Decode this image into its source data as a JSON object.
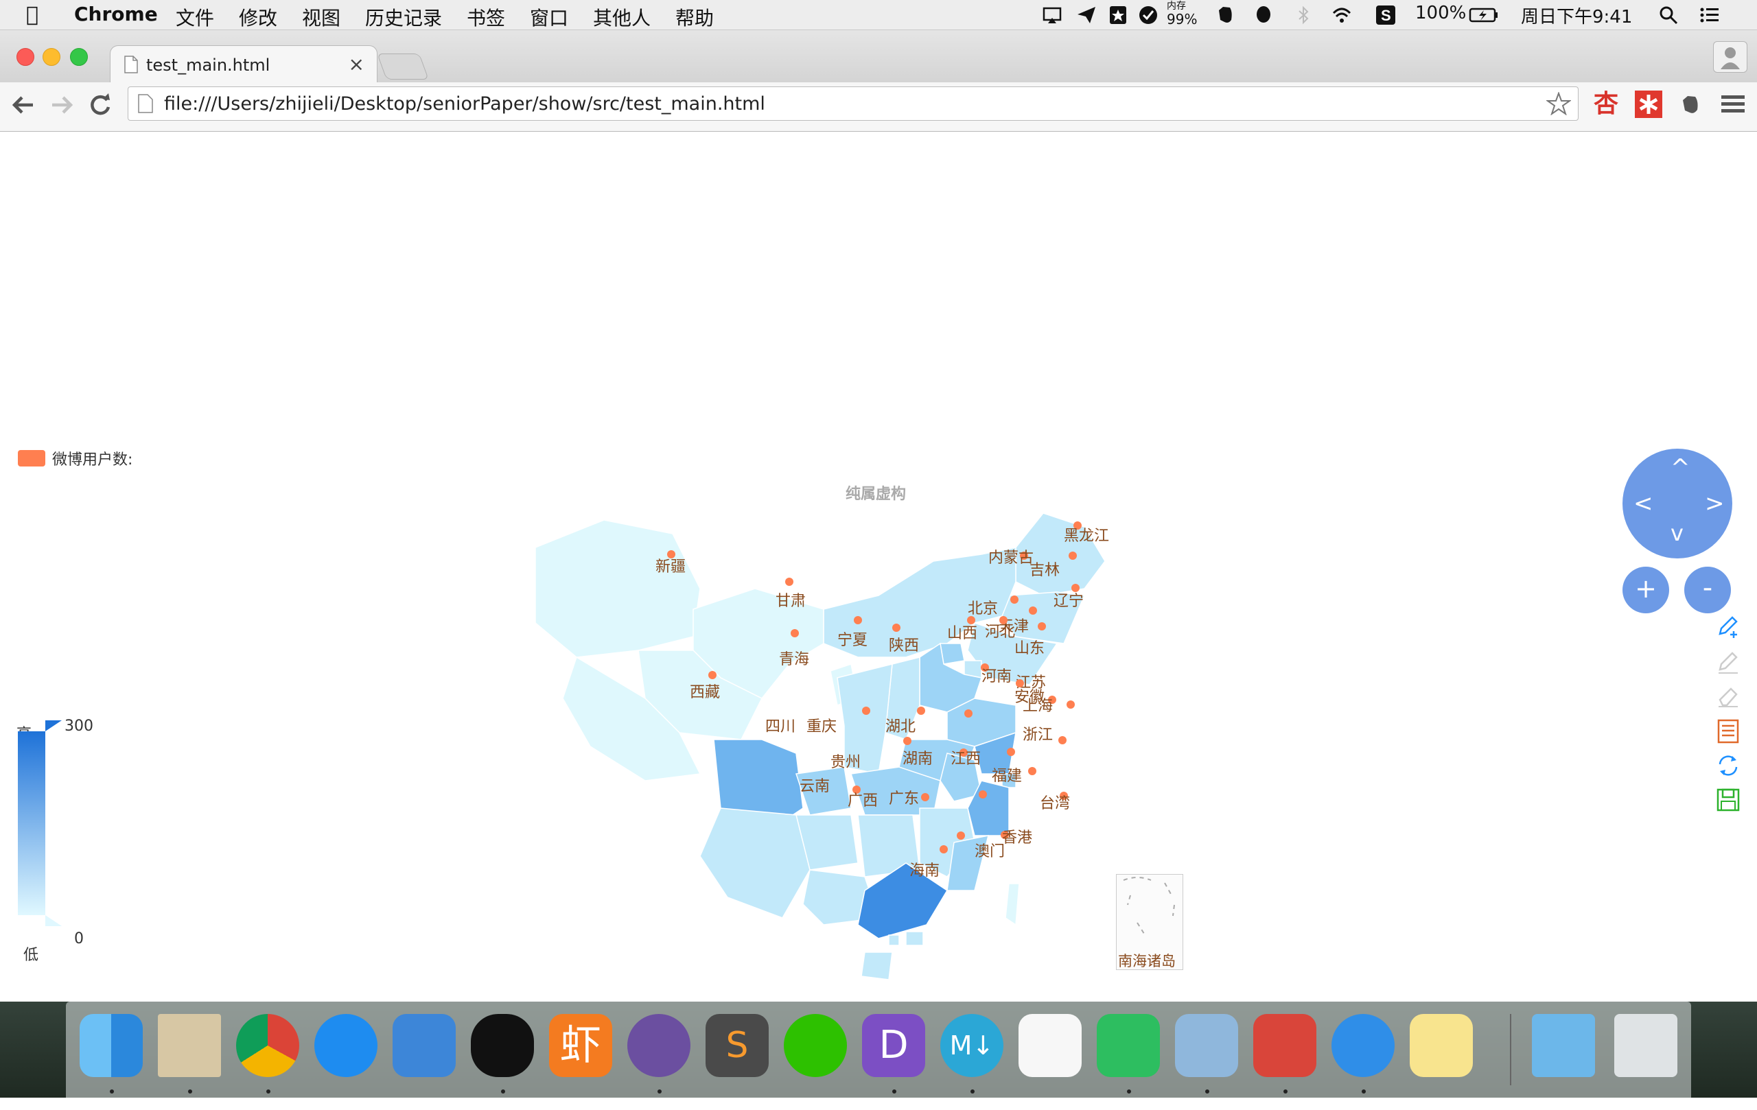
{
  "menubar": {
    "app_name": "Chrome",
    "items": [
      "文件",
      "修改",
      "视图",
      "历史记录",
      "书签",
      "窗口",
      "其他人",
      "帮助"
    ],
    "memory_label": "内存",
    "memory_value": "99%",
    "battery": "100%",
    "clock": "周日下午9:41"
  },
  "tab": {
    "title": "test_main.html",
    "close": "×"
  },
  "toolbar": {
    "url": "file:///Users/zhijieli/Desktop/seniorPaper/show/src/test_main.html"
  },
  "map": {
    "legend_label": "微博用户数:",
    "legend_color": "#ff7f50",
    "subtitle": "纯属虚构",
    "scale": {
      "high_label": "高",
      "low_label": "低",
      "max": "300",
      "min": "0",
      "color_high": "#1e72d8",
      "color_low": "#e0f8ff"
    },
    "provinces": [
      {
        "name": "黑龙江",
        "shade": 1
      },
      {
        "name": "吉林",
        "shade": 1
      },
      {
        "name": "辽宁",
        "shade": 1
      },
      {
        "name": "内蒙古",
        "shade": 1
      },
      {
        "name": "北京",
        "shade": 2
      },
      {
        "name": "天津",
        "shade": 1
      },
      {
        "name": "河北",
        "shade": 2
      },
      {
        "name": "山西",
        "shade": 1
      },
      {
        "name": "山东",
        "shade": 2
      },
      {
        "name": "新疆",
        "shade": 0
      },
      {
        "name": "甘肃",
        "shade": 0
      },
      {
        "name": "宁夏",
        "shade": 0
      },
      {
        "name": "陕西",
        "shade": 1
      },
      {
        "name": "青海",
        "shade": 0
      },
      {
        "name": "西藏",
        "shade": 0
      },
      {
        "name": "河南",
        "shade": 2
      },
      {
        "name": "江苏",
        "shade": 3
      },
      {
        "name": "安徽",
        "shade": 2
      },
      {
        "name": "上海",
        "shade": 2
      },
      {
        "name": "四川",
        "shade": 3
      },
      {
        "name": "重庆",
        "shade": 2
      },
      {
        "name": "湖北",
        "shade": 2
      },
      {
        "name": "浙江",
        "shade": 3
      },
      {
        "name": "贵州",
        "shade": 1
      },
      {
        "name": "湖南",
        "shade": 1
      },
      {
        "name": "江西",
        "shade": 1
      },
      {
        "name": "福建",
        "shade": 2
      },
      {
        "name": "云南",
        "shade": 1
      },
      {
        "name": "广西",
        "shade": 1
      },
      {
        "name": "广东",
        "shade": 4
      },
      {
        "name": "台湾",
        "shade": 0
      },
      {
        "name": "香港",
        "shade": 1
      },
      {
        "name": "澳门",
        "shade": 1
      },
      {
        "name": "海南",
        "shade": 1
      },
      {
        "name": "南海诸岛",
        "shade": 0
      }
    ],
    "controls": {
      "up": "^",
      "down": "v",
      "left": "<",
      "right": ">",
      "zoom_in": "+",
      "zoom_out": "-"
    },
    "toolbox": [
      "pen-add-icon",
      "pen-icon",
      "eraser-icon",
      "data-view-icon",
      "refresh-icon",
      "save-icon"
    ]
  }
}
